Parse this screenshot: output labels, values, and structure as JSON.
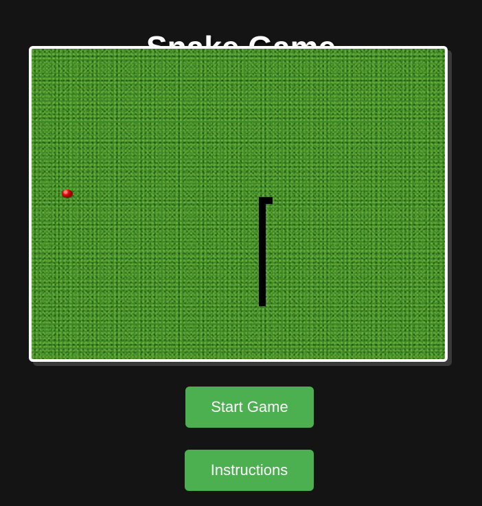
{
  "header": {
    "title": "Snake Game"
  },
  "game": {
    "food": "apple",
    "snake_direction": "up",
    "colors": {
      "board_border": "#ffffff",
      "board_grass": "#3f8a25",
      "snake": "#000000",
      "food": "#e01010",
      "background": "#141414"
    }
  },
  "controls": {
    "start_label": "Start Game",
    "instructions_label": "Instructions",
    "button_color": "#4caf50"
  }
}
